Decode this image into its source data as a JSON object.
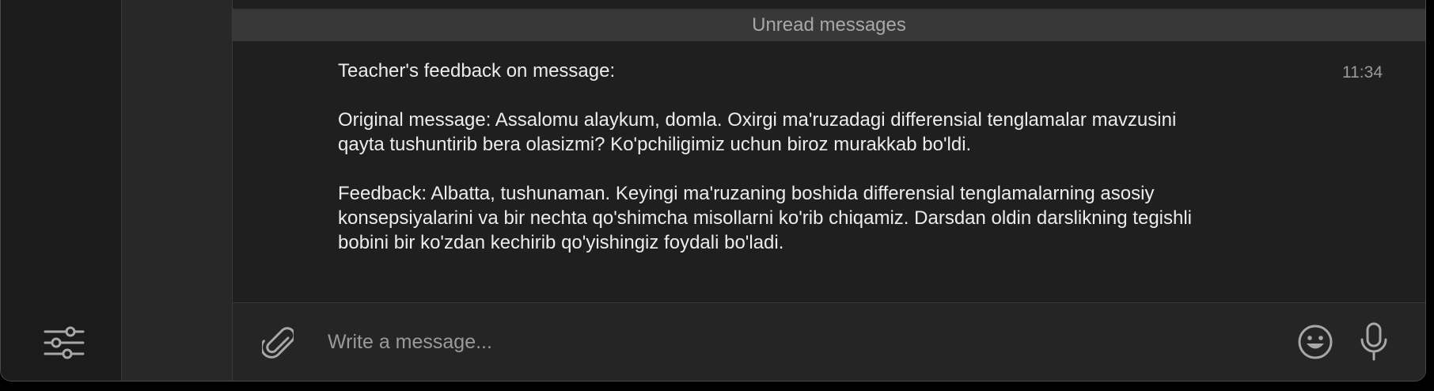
{
  "icons": {
    "filter": "sliders-icon",
    "attach": "paperclip-icon",
    "emoji": "smiley-icon",
    "mic": "microphone-icon"
  },
  "colors": {
    "background": "#1f1f1f",
    "unread_bar": "#383838",
    "text": "#ececec",
    "muted_text": "#9a9a9a"
  },
  "chat": {
    "unread_label": "Unread messages",
    "message": {
      "title": "Teacher's feedback on message:",
      "original": "Original message: Assalomu alaykum, domla. Oxirgi ma'ruzadagi differensial tenglamalar mavzusini qayta tushuntirib bera olasizmi? Ko'pchiligimiz uchun biroz murakkab bo'ldi.",
      "feedback": "Feedback: Albatta, tushunaman. Keyingi ma'ruzaning boshida differensial tenglamalarning asosiy konsepsiyalarini va bir nechta qo'shimcha misollarni ko'rib chiqamiz. Darsdan oldin darslikning tegishli bobini bir ko'zdan kechirib qo'yishingiz foydali bo'ladi.",
      "time": "11:34"
    }
  },
  "composer": {
    "placeholder": "Write a message..."
  }
}
